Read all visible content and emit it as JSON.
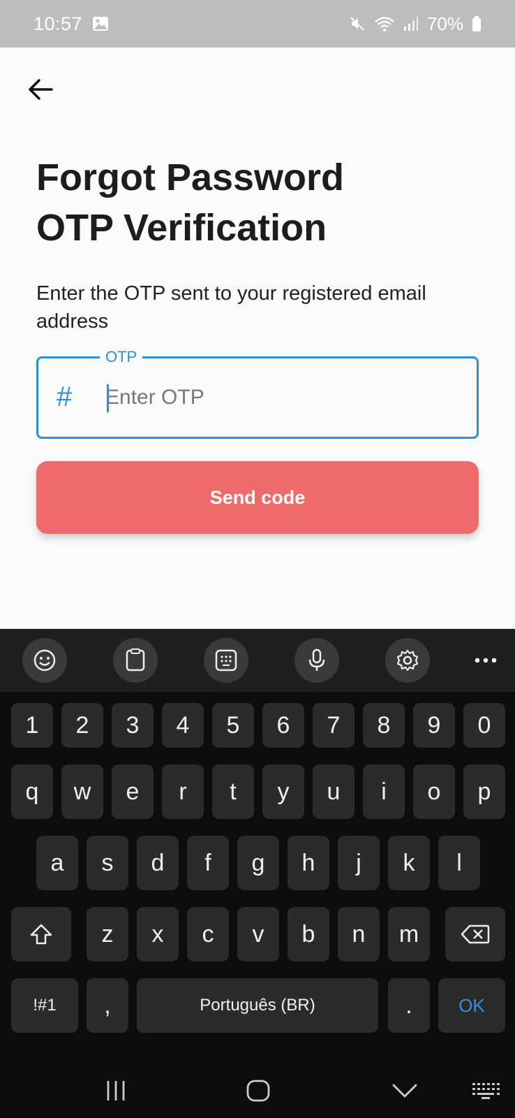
{
  "status_bar": {
    "time": "10:57",
    "battery": "70%",
    "icons": [
      "gallery-icon",
      "mute-icon",
      "wifi-icon",
      "signal-icon",
      "battery-icon"
    ]
  },
  "screen": {
    "title_line1": "Forgot Password",
    "title_line2": "OTP Verification",
    "subtitle": "Enter the OTP sent to your registered email address",
    "otp_label": "OTP",
    "otp_prefix": "#",
    "otp_placeholder": "Enter OTP",
    "otp_value": "",
    "send_button": "Send code"
  },
  "colors": {
    "accent": "#2f8fd6",
    "button": "#ef6b6b",
    "status_bar": "#bdbdbd",
    "keyboard_bg": "#0d0d0d",
    "key_bg": "#2b2b2b"
  },
  "keyboard": {
    "toolbar": [
      "emoji-icon",
      "clipboard-icon",
      "keypad-icon",
      "microphone-icon",
      "settings-icon",
      "more-icon"
    ],
    "row_numbers": [
      "1",
      "2",
      "3",
      "4",
      "5",
      "6",
      "7",
      "8",
      "9",
      "0"
    ],
    "row1": [
      "q",
      "w",
      "e",
      "r",
      "t",
      "y",
      "u",
      "i",
      "o",
      "p"
    ],
    "row2": [
      "a",
      "s",
      "d",
      "f",
      "g",
      "h",
      "j",
      "k",
      "l"
    ],
    "row3": [
      "z",
      "x",
      "c",
      "v",
      "b",
      "n",
      "m"
    ],
    "symbols_key": "!#1",
    "comma_key": ",",
    "space_key": "Português (BR)",
    "period_key": ".",
    "ok_key": "OK"
  },
  "nav_bar": [
    "recents-icon",
    "home-icon",
    "back-icon",
    "keyboard-icon"
  ]
}
